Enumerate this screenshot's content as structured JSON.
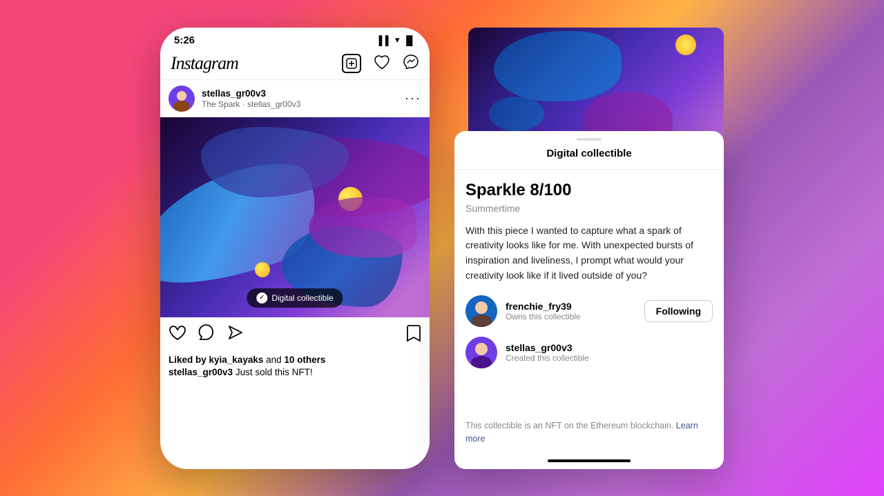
{
  "background": {
    "gradient": "linear-gradient(135deg, #f5467a, #ff6b35, #ffb347, #9b59b6, #e040fb)"
  },
  "phone": {
    "status_bar": {
      "time": "5:26",
      "icons": "▌▌ ᯤ 🔋"
    },
    "header": {
      "logo": "Instagram",
      "add_icon": "+",
      "heart_icon": "♡",
      "messenger_icon": "✉"
    },
    "post": {
      "username": "stellas_gr00v3",
      "subtitle": "The Spark · stellas_gr00v3",
      "more_icon": "···",
      "badge_text": "Digital collectible",
      "liked_by": "Liked by kyia_kayaks and 10 others",
      "caption_user": "stellas_gr00v3",
      "caption_text": "Just sold this NFT!"
    },
    "actions": {
      "like": "♡",
      "comment": "◯",
      "share": "▷",
      "bookmark": "⊡"
    }
  },
  "panel": {
    "handle": "",
    "title": "Digital collectible",
    "nft_title": "Sparkle 8/100",
    "nft_subtitle": "Summertime",
    "description": "With this piece I wanted to capture what a spark of creativity looks like for me. With unexpected bursts of inspiration and liveliness, I prompt what would your creativity look like if it lived outside of you?",
    "owner": {
      "username": "frenchie_fry39",
      "role": "Owns this collectible",
      "action": "Following"
    },
    "creator": {
      "username": "stellas_gr00v3",
      "role": "Created this collectible"
    },
    "footer_text": "This collectible is an NFT on the Ethereum blockchain.",
    "footer_link": "Learn more",
    "bottom_bar": ""
  }
}
